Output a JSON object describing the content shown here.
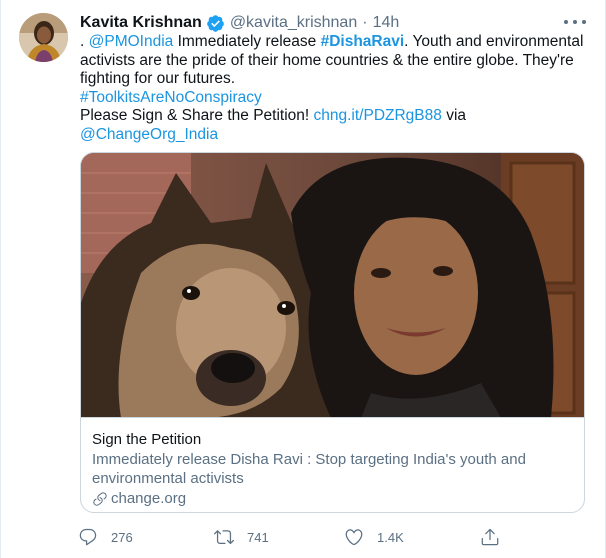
{
  "tweet": {
    "author_name": "Kavita Krishnan",
    "author_handle": "@kavita_krishnan",
    "separator": "·",
    "time": "14h",
    "verified": true,
    "text": {
      "lead": ". ",
      "mention_1": "@PMOIndia",
      "part_1": " Immediately release ",
      "hashtag_1": "#DishaRavi",
      "part_2": ". Youth and environmental activists are the pride of their home countries & the entire globe. They're fighting for our futures.",
      "hashtag_2": "#ToolkitsAreNoConspiracy",
      "part_3": "Please Sign & Share the Petition! ",
      "short_link": "chng.it/PDZRgB88",
      "part_4": " via",
      "mention_2": "@ChangeOrg_India"
    }
  },
  "card": {
    "title": "Sign the Petition",
    "description": "Immediately release Disha Ravi : Stop targeting India's youth and environmental activists",
    "domain": "change.org"
  },
  "actions": {
    "replies": "276",
    "retweets": "741",
    "likes": "1.4K"
  },
  "colors": {
    "link": "#1b95e0",
    "secondary_text": "#5b7083",
    "verified_badge": "#1da1f2",
    "border": "#ccd6dd"
  },
  "icons": [
    "verified-icon",
    "more-icon",
    "link-icon",
    "reply-icon",
    "retweet-icon",
    "like-icon",
    "share-icon"
  ]
}
